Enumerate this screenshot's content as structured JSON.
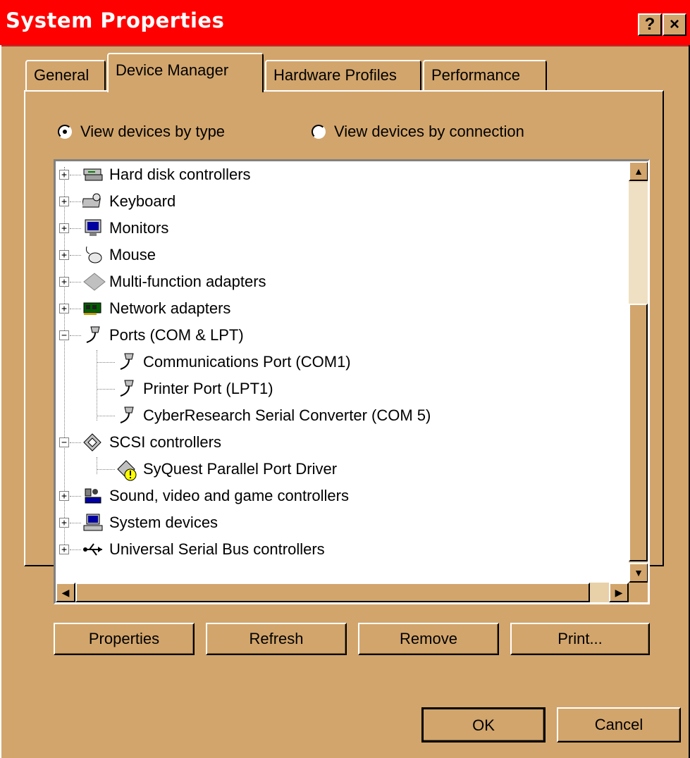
{
  "window": {
    "title": "System Properties",
    "help_glyph": "?",
    "close_glyph": "×"
  },
  "tabs": [
    {
      "label": "General"
    },
    {
      "label": "Device Manager"
    },
    {
      "label": "Hardware Profiles"
    },
    {
      "label": "Performance"
    }
  ],
  "view_options": {
    "by_type": {
      "label": "View devices by type",
      "selected": true
    },
    "by_connection": {
      "label": "View devices by connection",
      "selected": false
    }
  },
  "devices": [
    {
      "label": "Hard disk controllers",
      "icon": "hard-disk-icon",
      "expanded": false
    },
    {
      "label": "Keyboard",
      "icon": "keyboard-icon",
      "expanded": false
    },
    {
      "label": "Monitors",
      "icon": "monitor-icon",
      "expanded": false
    },
    {
      "label": "Mouse",
      "icon": "mouse-icon",
      "expanded": false
    },
    {
      "label": "Multi-function adapters",
      "icon": "multifunction-icon",
      "expanded": false
    },
    {
      "label": "Network adapters",
      "icon": "network-card-icon",
      "expanded": false
    },
    {
      "label": "Ports (COM & LPT)",
      "icon": "port-icon",
      "expanded": true,
      "children": [
        {
          "label": "Communications Port (COM1)",
          "icon": "port-icon"
        },
        {
          "label": "Printer Port (LPT1)",
          "icon": "port-icon"
        },
        {
          "label": "CyberResearch Serial Converter (COM 5)",
          "icon": "port-icon"
        }
      ]
    },
    {
      "label": "SCSI controllers",
      "icon": "scsi-icon",
      "expanded": true,
      "children": [
        {
          "label": "SyQuest Parallel Port Driver",
          "icon": "scsi-warning-icon"
        }
      ]
    },
    {
      "label": "Sound, video and game controllers",
      "icon": "sound-icon",
      "expanded": false
    },
    {
      "label": "System devices",
      "icon": "computer-icon",
      "expanded": false
    },
    {
      "label": "Universal Serial Bus controllers",
      "icon": "usb-icon",
      "expanded": false
    }
  ],
  "buttons": {
    "properties": "Properties",
    "refresh": "Refresh",
    "remove": "Remove",
    "print": "Print...",
    "ok": "OK",
    "cancel": "Cancel"
  },
  "colors": {
    "title_bar": "#ff0000",
    "face": "#d2a56c",
    "list_bg": "#ffffff"
  }
}
